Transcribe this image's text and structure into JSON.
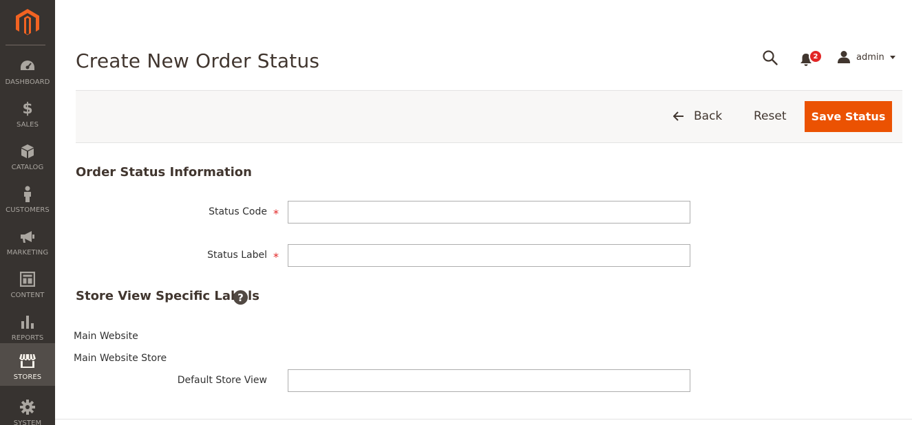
{
  "sidebar": {
    "logo_icon": "magento-logo-icon",
    "items": [
      {
        "label": "DASHBOARD",
        "icon": "dashboard-icon"
      },
      {
        "label": "SALES",
        "icon": "dollar-icon"
      },
      {
        "label": "CATALOG",
        "icon": "box-icon"
      },
      {
        "label": "CUSTOMERS",
        "icon": "person-icon"
      },
      {
        "label": "MARKETING",
        "icon": "megaphone-icon"
      },
      {
        "label": "CONTENT",
        "icon": "layout-icon"
      },
      {
        "label": "REPORTS",
        "icon": "bar-chart-icon"
      },
      {
        "label": "STORES",
        "icon": "storefront-icon",
        "active": true
      },
      {
        "label": "SYSTEM",
        "icon": "gear-icon"
      }
    ]
  },
  "header": {
    "title": "Create New Order Status",
    "notifications_count": "2",
    "user_name": "admin"
  },
  "actions": {
    "back_label": "Back",
    "reset_label": "Reset",
    "save_label": "Save Status"
  },
  "form": {
    "section_title": "Order Status Information",
    "status_code": {
      "label": "Status Code",
      "value": ""
    },
    "status_label": {
      "label": "Status Label",
      "value": ""
    },
    "store_labels_title": "Store View Specific Labels",
    "help_glyph": "?",
    "website": "Main Website",
    "store": "Main Website Store",
    "store_view": {
      "label": "Default Store View",
      "value": ""
    },
    "required_mark": "*"
  },
  "colors": {
    "sidebar_bg": "#373330",
    "sidebar_active": "#524d49",
    "accent": "#eb5202",
    "badge": "#e22626"
  }
}
